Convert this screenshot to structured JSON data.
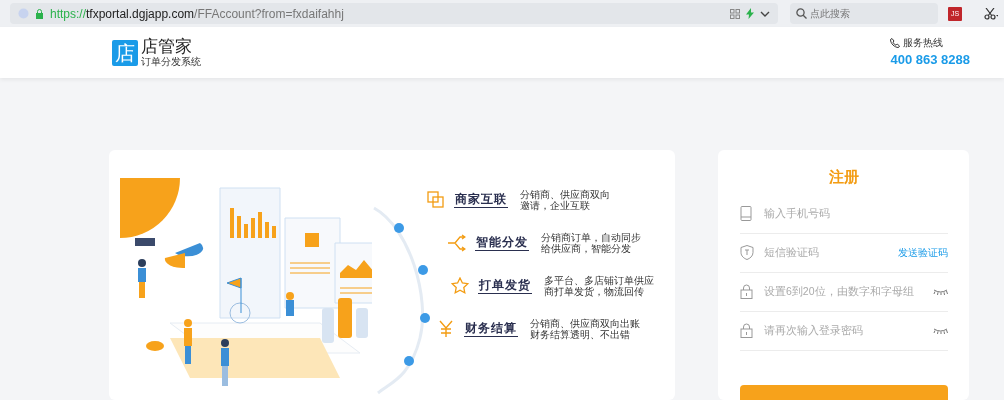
{
  "browser": {
    "url_scheme": "https://",
    "url_host": "tfxportal.dgjapp.com",
    "url_path": "/FFAccount?from=fxdaifahhj",
    "search_placeholder": "点此搜索",
    "extension_label": "JS"
  },
  "header": {
    "logo_char": "店",
    "brand": "店管家",
    "tagline": "订单分发系统",
    "hotline_label": "服务热线",
    "hotline": "400 863 8288"
  },
  "features": [
    {
      "kind": "link",
      "title": "商家互联",
      "desc_lines": [
        "分销商、供应商双向",
        "邀请，企业互联"
      ]
    },
    {
      "kind": "share",
      "title": "智能分发",
      "desc_lines": [
        "分销商订单，自动同步",
        "给供应商，智能分发"
      ]
    },
    {
      "kind": "star",
      "title": "打单发货",
      "desc_lines": [
        "多平台、多店铺订单供应",
        "商打单发货，物流回传"
      ]
    },
    {
      "kind": "yen",
      "title": "财务结算",
      "desc_lines": [
        "分销商、供应商双向出账",
        "财务结算透明、不出错"
      ]
    }
  ],
  "form": {
    "title": "注册",
    "fields": [
      {
        "kind": "phone",
        "placeholder": "输入手机号码"
      },
      {
        "kind": "code",
        "placeholder": "短信验证码",
        "action": "发送验证码"
      },
      {
        "kind": "password",
        "placeholder": "设置6到20位，由数字和字母组"
      },
      {
        "kind": "password",
        "placeholder": "请再次输入登录密码"
      }
    ]
  }
}
